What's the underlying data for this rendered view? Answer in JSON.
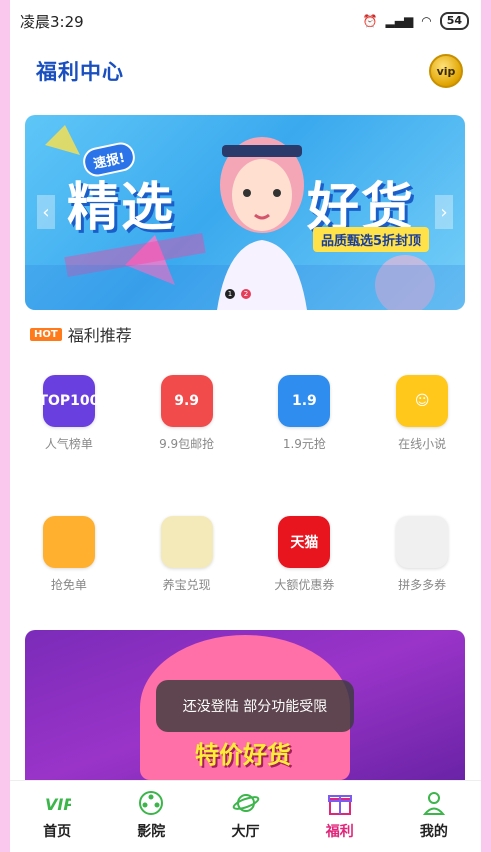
{
  "status_bar": {
    "time": "凌晨3:29",
    "battery": "54"
  },
  "header": {
    "title": "福利中心",
    "vip_label": "vip"
  },
  "banner": {
    "tag": "速报!",
    "title_left": "精选",
    "title_right": "好货",
    "subtitle": "品质甄选5折封顶",
    "dots": [
      "1",
      "2"
    ],
    "active_dot": 1
  },
  "section": {
    "badge": "HOT",
    "title": "福利推荐"
  },
  "grid": [
    {
      "label": "人气榜单",
      "icon_text": "TOP100",
      "icon": "top100-icon",
      "color": "#6a3fe0"
    },
    {
      "label": "9.9包邮抢",
      "icon_text": "9.9",
      "icon": "free-shipping-icon",
      "color": "#f24b4b"
    },
    {
      "label": "1.9元抢",
      "icon_text": "1.9",
      "icon": "box-icon",
      "color": "#2f8df0"
    },
    {
      "label": "在线小说",
      "icon_text": "☺",
      "icon": "smiley-book-icon",
      "color": "#ffc81a"
    },
    {
      "label": "抢免单",
      "icon_text": "",
      "icon": "free-order-icon",
      "color": "#ffb02e"
    },
    {
      "label": "养宝兑现",
      "icon_text": "",
      "icon": "pet-icon",
      "color": "#f4e9b8"
    },
    {
      "label": "大额优惠券",
      "icon_text": "天猫",
      "icon": "tmall-icon",
      "color": "#e8141e"
    },
    {
      "label": "拼多多券",
      "icon_text": "",
      "icon": "pinduoduo-icon",
      "color": "#f0f0f0"
    }
  ],
  "promo": {
    "text": "特价好货"
  },
  "toast": {
    "message": "还没登陆 部分功能受限"
  },
  "tabs": [
    {
      "label": "首页",
      "icon": "home-vip-icon"
    },
    {
      "label": "影院",
      "icon": "film-reel-icon"
    },
    {
      "label": "大厅",
      "icon": "planet-icon"
    },
    {
      "label": "福利",
      "icon": "gift-icon",
      "active": true
    },
    {
      "label": "我的",
      "icon": "user-icon"
    }
  ],
  "colors": {
    "accent": "#e0257a",
    "title_blue": "#1a4fbf"
  }
}
